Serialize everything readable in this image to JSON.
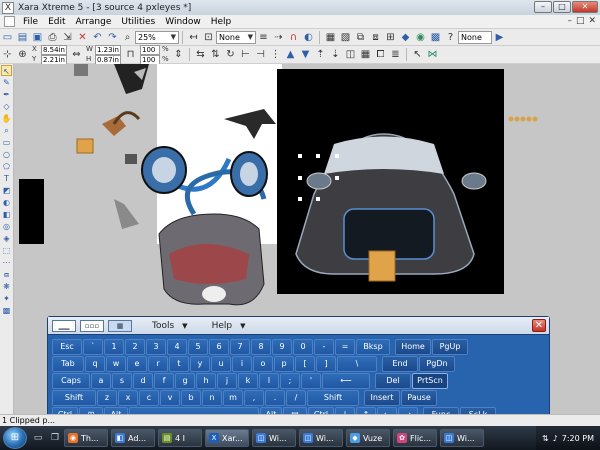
{
  "window": {
    "title": "Xara Xtreme 5 - [3 source 4 pxleyes *]",
    "controls": [
      "–",
      "□",
      "✕"
    ]
  },
  "menubar": {
    "items": [
      "File",
      "Edit",
      "Arrange",
      "Utilities",
      "Window",
      "Help"
    ],
    "mdi_controls": [
      "–",
      "□",
      "✕"
    ]
  },
  "toolbar1": {
    "zoom": "25%",
    "fill_combo": "None",
    "none_combo2": "None"
  },
  "toolbar2": {
    "x": "8.54in",
    "y": "2.21in",
    "w": "1.23in",
    "h": "0.87in",
    "scale_w": "100",
    "scale_h": "100",
    "scale_unit": "%"
  },
  "status": {
    "text": "1 Clipped p..."
  },
  "osk": {
    "menus": [
      "Tools",
      "Help"
    ],
    "rows": [
      [
        "Esc",
        "`",
        "1",
        "2",
        "3",
        "4",
        "5",
        "6",
        "7",
        "8",
        "9",
        "0",
        "-",
        "=",
        "Bksp",
        "Home",
        "PgUp"
      ],
      [
        "Tab",
        "q",
        "w",
        "e",
        "r",
        "t",
        "y",
        "u",
        "i",
        "o",
        "p",
        "[",
        "]",
        "\\",
        "End",
        "PgDn"
      ],
      [
        "Caps",
        "a",
        "s",
        "d",
        "f",
        "g",
        "h",
        "j",
        "k",
        "l",
        ";",
        "'",
        "⟵",
        "Del",
        "PrtScn"
      ],
      [
        "Shift",
        "z",
        "x",
        "c",
        "v",
        "b",
        "n",
        "m",
        ",",
        ".",
        "/",
        "Shift",
        "Insert",
        "Pause"
      ],
      [
        "Ctrl",
        "⊞",
        "Alt",
        "",
        "Alt",
        "▤",
        "Ctrl",
        "↓",
        "↑",
        "←",
        "→",
        "Func",
        "ScLk"
      ]
    ]
  },
  "taskbar": {
    "tasks": [
      "Th...",
      "Ad...",
      "4 I",
      "Xar...",
      "Wi...",
      "Wi...",
      "Vuze",
      "Flic...",
      "Wi..."
    ],
    "clock": "7:20 PM"
  }
}
